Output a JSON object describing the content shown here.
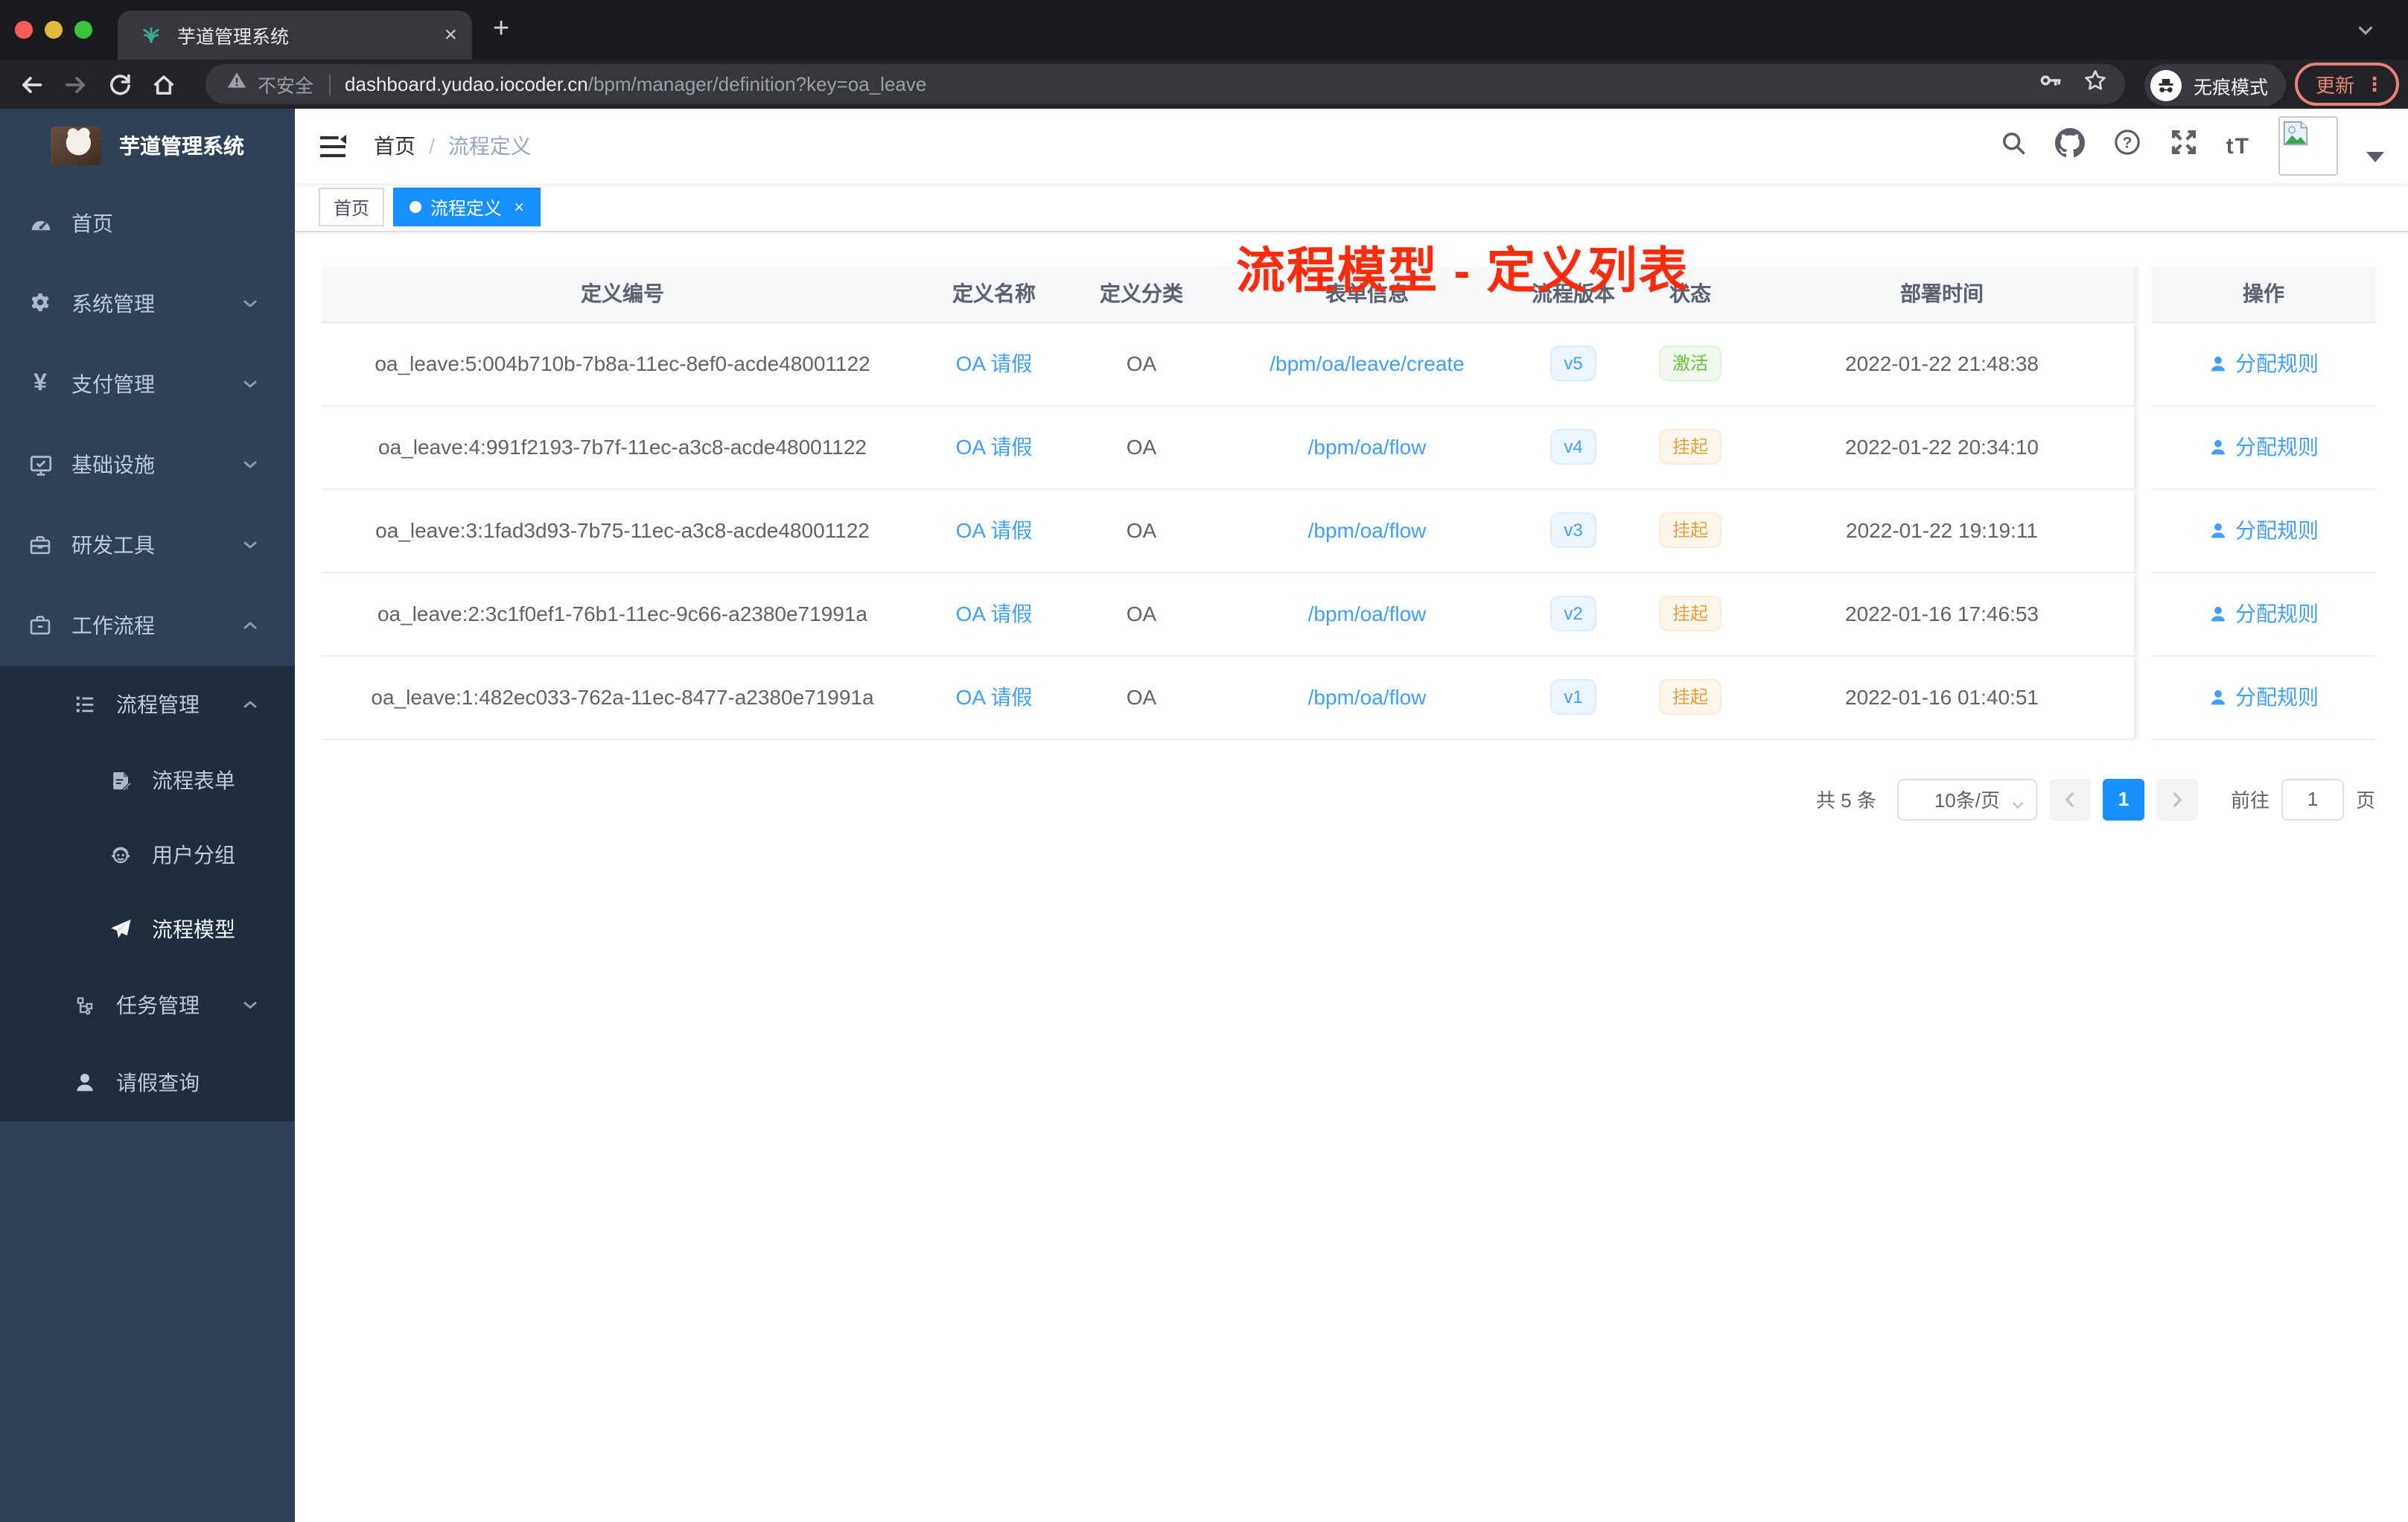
{
  "browser": {
    "tab_title": "芋道管理系统",
    "close_glyph": "×",
    "new_tab_glyph": "+",
    "address": {
      "security": "不安全",
      "host": "dashboard.yudao.iocoder.cn",
      "path": "/bpm/manager/definition?key=oa_leave"
    },
    "incognito_label": "无痕模式",
    "update_label": "更新",
    "menu_glyph": "⋮"
  },
  "sidebar": {
    "logo_title": "芋道管理系统",
    "items": [
      {
        "label": "首页"
      },
      {
        "label": "系统管理"
      },
      {
        "label": "支付管理"
      },
      {
        "label": "基础设施"
      },
      {
        "label": "研发工具"
      },
      {
        "label": "工作流程"
      },
      {
        "label": "流程管理"
      },
      {
        "label": "流程表单"
      },
      {
        "label": "用户分组"
      },
      {
        "label": "流程模型"
      },
      {
        "label": "任务管理"
      },
      {
        "label": "请假查询"
      }
    ]
  },
  "navbar": {
    "breadcrumb_home": "首页",
    "breadcrumb_sep": "/",
    "breadcrumb_current": "流程定义"
  },
  "annotation": {
    "text": "流程模型 - 定义列表"
  },
  "tags": {
    "home": "首页",
    "active": "流程定义",
    "close_glyph": "×"
  },
  "table": {
    "columns": [
      "定义编号",
      "定义名称",
      "定义分类",
      "表单信息",
      "流程版本",
      "状态",
      "部署时间",
      "操作"
    ],
    "rows": [
      {
        "id": "oa_leave:5:004b710b-7b8a-11ec-8ef0-acde48001122",
        "name": "OA 请假",
        "category": "OA",
        "form": "/bpm/oa/leave/create",
        "version": "v5",
        "status": "激活",
        "time": "2022-01-22 21:48:38",
        "op": "分配规则"
      },
      {
        "id": "oa_leave:4:991f2193-7b7f-11ec-a3c8-acde48001122",
        "name": "OA 请假",
        "category": "OA",
        "form": "/bpm/oa/flow",
        "version": "v4",
        "status": "挂起",
        "time": "2022-01-22 20:34:10",
        "op": "分配规则"
      },
      {
        "id": "oa_leave:3:1fad3d93-7b75-11ec-a3c8-acde48001122",
        "name": "OA 请假",
        "category": "OA",
        "form": "/bpm/oa/flow",
        "version": "v3",
        "status": "挂起",
        "time": "2022-01-22 19:19:11",
        "op": "分配规则"
      },
      {
        "id": "oa_leave:2:3c1f0ef1-76b1-11ec-9c66-a2380e71991a",
        "name": "OA 请假",
        "category": "OA",
        "form": "/bpm/oa/flow",
        "version": "v2",
        "status": "挂起",
        "time": "2022-01-16 17:46:53",
        "op": "分配规则"
      },
      {
        "id": "oa_leave:1:482ec033-762a-11ec-8477-a2380e71991a",
        "name": "OA 请假",
        "category": "OA",
        "form": "/bpm/oa/flow",
        "version": "v1",
        "status": "挂起",
        "time": "2022-01-16 01:40:51",
        "op": "分配规则"
      }
    ]
  },
  "pagination": {
    "total": "共 5 条",
    "page_size": "10条/页",
    "page": "1",
    "goto_label": "前往",
    "goto_value": "1",
    "unit_label": "页"
  },
  "colors": {
    "accent": "#409EFF",
    "tag_active": "#1890FF",
    "status_active": "#67C23A",
    "status_suspended": "#E6A23C",
    "sidebar_bg": "#304156",
    "submenu_bg": "#1F2D3D",
    "annotation_red": "#FE2B0C"
  }
}
